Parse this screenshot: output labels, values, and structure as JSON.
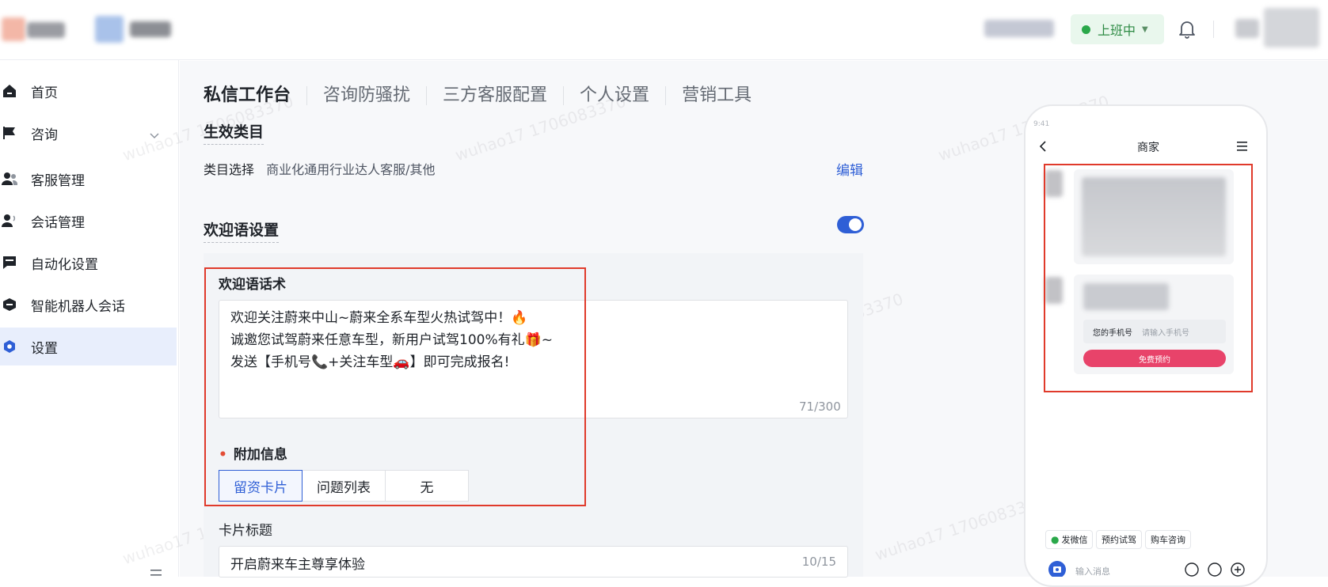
{
  "header": {
    "status": {
      "label": "上班中",
      "color": "#2aa84a"
    }
  },
  "sidebar": {
    "items": [
      {
        "label": "首页",
        "icon": "home-icon"
      },
      {
        "label": "咨询",
        "icon": "flag-icon",
        "expandable": true
      },
      {
        "label": "客服管理",
        "icon": "users-icon"
      },
      {
        "label": "会话管理",
        "icon": "user-voice-icon"
      },
      {
        "label": "自动化设置",
        "icon": "chat-square-icon"
      },
      {
        "label": "智能机器人会话",
        "icon": "robot-icon"
      },
      {
        "label": "设置",
        "icon": "settings-icon",
        "active": true
      }
    ]
  },
  "tabs": [
    "私信工作台",
    "咨询防骚扰",
    "三方客服配置",
    "个人设置",
    "营销工具"
  ],
  "watermark": "wuhao17 1706083370",
  "category": {
    "section_title": "生效类目",
    "label": "类目选择",
    "value": "商业化通用行业达人客服/其他",
    "edit_label": "编辑"
  },
  "welcome": {
    "section_title": "欢迎语设置",
    "enabled": true,
    "script_label": "欢迎语话术",
    "script_text": "欢迎关注蔚来中山~蔚来全系车型火热试驾中！🔥\n诚邀您试驾蔚来任意车型，新用户试驾100%有礼🎁~\n发送【手机号📞+关注车型🚗】即可完成报名!",
    "script_count": "71/300",
    "extra_label": "附加信息",
    "extra_options": [
      "留资卡片",
      "问题列表",
      "无"
    ],
    "extra_selected": "留资卡片",
    "card_title_label": "卡片标题",
    "card_title_value": "开启蔚来车主尊享体验",
    "card_title_count": "10/15"
  },
  "preview": {
    "time": "9:41",
    "title": "商家",
    "phone_field_label": "您的手机号",
    "phone_field_placeholder": "请输入手机号",
    "submit_label": "免费预约",
    "quick_replies": [
      "发微信",
      "预约试驾",
      "购车咨询"
    ],
    "message_placeholder": "输入消息"
  },
  "colors": {
    "accent": "#2f5fd6",
    "highlight": "#e03a2b",
    "cta": "#e8436a"
  }
}
